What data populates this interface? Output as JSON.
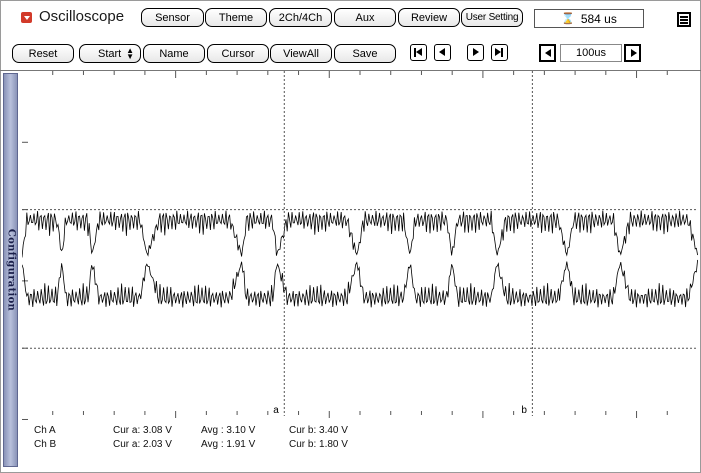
{
  "app": {
    "title": "Oscilloscope",
    "icon": "dropdown-icon"
  },
  "header": {
    "tabs": [
      {
        "label": "Sensor"
      },
      {
        "label": "Theme"
      },
      {
        "label": "2Ch/4Ch"
      },
      {
        "label": "Aux"
      },
      {
        "label": "Review"
      },
      {
        "label": "User Setting"
      }
    ],
    "time_readout": "584 us",
    "time_icon": "hourglass-icon",
    "menu_icon": "hamburger-menu-icon"
  },
  "toolbar": {
    "reset_label": "Reset",
    "start_label": "Start",
    "name_label": "Name",
    "cursor_label": "Cursor",
    "viewall_label": "ViewAll",
    "save_label": "Save",
    "nav_icons": [
      "skip-to-start-icon",
      "step-back-icon",
      "step-forward-icon",
      "skip-to-end-icon"
    ],
    "timebase_value": "100us",
    "timebase_icons": [
      "timebase-decrease-icon",
      "timebase-increase-icon"
    ]
  },
  "side_panel": {
    "label": "Configuration"
  },
  "plot": {
    "cursor_a_label": "a",
    "cursor_b_label": "b",
    "cursor_a_position_ratio": 0.388,
    "cursor_b_position_ratio": 0.755,
    "colors": {
      "trace": "#000000",
      "grid": "#555555",
      "background": "#ffffff"
    }
  },
  "readouts": {
    "channels": [
      {
        "name": "Ch A",
        "cur_a": "Cur a: 3.08 V",
        "avg": "Avg  : 3.10 V",
        "cur_b": "Cur b: 3.40 V"
      },
      {
        "name": "Ch B",
        "cur_a": "Cur a: 2.03 V",
        "avg": "Avg  : 1.91 V",
        "cur_b": "Cur b: 1.80 V"
      }
    ]
  }
}
